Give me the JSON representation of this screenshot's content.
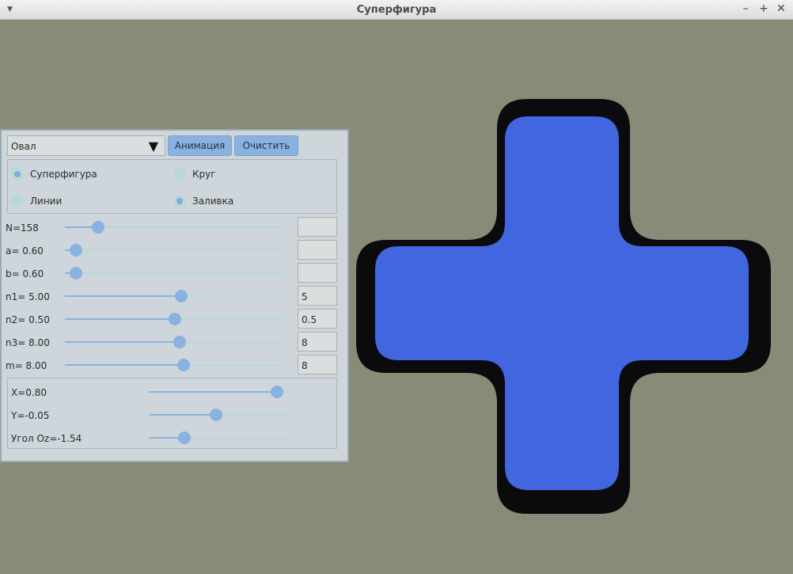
{
  "window": {
    "title": "Суперфигура"
  },
  "panel": {
    "shape_select": "Овал",
    "animation_button": "Анимация",
    "clear_button": "Очистить",
    "modes": [
      {
        "label": "Суперфигура",
        "selected": true
      },
      {
        "label": "Круг",
        "selected": false
      },
      {
        "label": "Линии",
        "selected": false
      },
      {
        "label": "Заливка",
        "selected": true
      }
    ],
    "params": [
      {
        "label": "N=158",
        "value": 0.15,
        "field": ""
      },
      {
        "label": "a= 0.60",
        "value": 0.05,
        "field": ""
      },
      {
        "label": "b= 0.60",
        "value": 0.05,
        "field": ""
      },
      {
        "label": "n1= 5.00",
        "value": 0.53,
        "field": "5"
      },
      {
        "label": "n2= 0.50",
        "value": 0.5,
        "field": "0.5"
      },
      {
        "label": "n3= 8.00",
        "value": 0.52,
        "field": "8"
      },
      {
        "label": "m=  8.00",
        "value": 0.54,
        "field": "8"
      }
    ],
    "transform": [
      {
        "label": "X=0.80",
        "value": 0.9
      },
      {
        "label": "Y=-0.05",
        "value": 0.47
      },
      {
        "label": "Угол Oz=-1.54",
        "value": 0.25
      }
    ]
  },
  "colors": {
    "background": "#898a78",
    "fill": "#4166e0",
    "outline": "#0b0b0d",
    "accent": "#8ab2e0"
  }
}
